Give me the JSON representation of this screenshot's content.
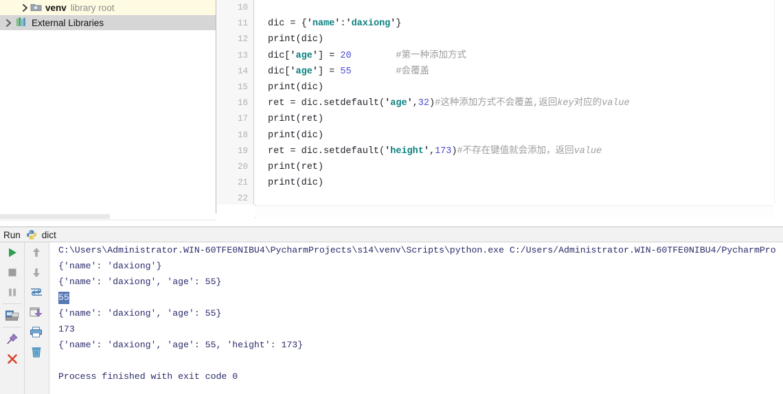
{
  "sidebar": {
    "rows": [
      {
        "label": "venv",
        "sublabel": "library root",
        "icon": "folder-icon",
        "chevron": "chevron-right-icon",
        "state": "highlighted"
      },
      {
        "label": "External Libraries",
        "sublabel": "",
        "icon": "library-bars-icon",
        "chevron": "chevron-right-icon",
        "state": "selected"
      }
    ]
  },
  "editor": {
    "line_numbers": [
      "10",
      "11",
      "12",
      "13",
      "14",
      "15",
      "16",
      "17",
      "18",
      "19",
      "20",
      "21",
      "22"
    ],
    "lines": [
      {
        "n": "10",
        "segments": []
      },
      {
        "n": "11",
        "segments": [
          {
            "t": "dic = {",
            "c": "plain"
          },
          {
            "t": "'",
            "c": "q"
          },
          {
            "t": "name",
            "c": "str"
          },
          {
            "t": "'",
            "c": "q"
          },
          {
            "t": ":",
            "c": "plain"
          },
          {
            "t": "'",
            "c": "q"
          },
          {
            "t": "daxiong",
            "c": "str"
          },
          {
            "t": "'",
            "c": "q"
          },
          {
            "t": "}",
            "c": "plain"
          }
        ]
      },
      {
        "n": "12",
        "segments": [
          {
            "t": "print(dic)",
            "c": "plain"
          }
        ]
      },
      {
        "n": "13",
        "segments": [
          {
            "t": "dic[",
            "c": "plain"
          },
          {
            "t": "'",
            "c": "q"
          },
          {
            "t": "age",
            "c": "str"
          },
          {
            "t": "'",
            "c": "q"
          },
          {
            "t": "] = ",
            "c": "plain"
          },
          {
            "t": "20",
            "c": "num"
          },
          {
            "t": "        ",
            "c": "plain"
          },
          {
            "t": "#第一种添加方式",
            "c": "cmt"
          }
        ]
      },
      {
        "n": "14",
        "segments": [
          {
            "t": "dic[",
            "c": "plain"
          },
          {
            "t": "'",
            "c": "q"
          },
          {
            "t": "age",
            "c": "str"
          },
          {
            "t": "'",
            "c": "q"
          },
          {
            "t": "] = ",
            "c": "plain"
          },
          {
            "t": "55",
            "c": "num"
          },
          {
            "t": "        ",
            "c": "plain"
          },
          {
            "t": "#会覆盖",
            "c": "cmt"
          }
        ]
      },
      {
        "n": "15",
        "segments": [
          {
            "t": "print(dic)",
            "c": "plain"
          }
        ]
      },
      {
        "n": "16",
        "segments": [
          {
            "t": "ret = dic.setdefault(",
            "c": "plain"
          },
          {
            "t": "'",
            "c": "q"
          },
          {
            "t": "age",
            "c": "str"
          },
          {
            "t": "'",
            "c": "q"
          },
          {
            "t": ",",
            "c": "plain"
          },
          {
            "t": "32",
            "c": "num"
          },
          {
            "t": ")",
            "c": "plain"
          },
          {
            "t": "#这种添加方式不会覆盖,返回",
            "c": "cmt"
          },
          {
            "t": "key",
            "c": "cmt-i"
          },
          {
            "t": "对应的",
            "c": "cmt"
          },
          {
            "t": "value",
            "c": "cmt-i"
          }
        ]
      },
      {
        "n": "17",
        "segments": [
          {
            "t": "print(ret)",
            "c": "plain"
          }
        ]
      },
      {
        "n": "18",
        "segments": [
          {
            "t": "print(dic)",
            "c": "plain"
          }
        ]
      },
      {
        "n": "19",
        "segments": [
          {
            "t": "ret = dic.setdefault(",
            "c": "plain"
          },
          {
            "t": "'",
            "c": "q"
          },
          {
            "t": "height",
            "c": "str"
          },
          {
            "t": "'",
            "c": "q"
          },
          {
            "t": ",",
            "c": "plain"
          },
          {
            "t": "173",
            "c": "num"
          },
          {
            "t": ")",
            "c": "plain"
          },
          {
            "t": "#不存在键值就会添加，返回",
            "c": "cmt"
          },
          {
            "t": "value",
            "c": "cmt-i"
          }
        ]
      },
      {
        "n": "20",
        "segments": [
          {
            "t": "print(ret)",
            "c": "plain"
          }
        ]
      },
      {
        "n": "21",
        "segments": [
          {
            "t": "print(dic)",
            "c": "plain"
          }
        ]
      },
      {
        "n": "22",
        "segments": []
      }
    ]
  },
  "run_panel": {
    "title": "Run",
    "tab_name": "dict",
    "tab_icon": "python-file-icon",
    "toolbar_left": [
      {
        "name": "rerun-button",
        "icon": "play-icon"
      },
      {
        "name": "stop-button",
        "icon": "stop-square-icon"
      },
      {
        "name": "pause-button",
        "icon": "pause-icon"
      },
      {
        "name": "restore-layout-button",
        "icon": "restore-layout-icon"
      },
      {
        "name": "pin-tab-button",
        "icon": "pin-icon"
      },
      {
        "name": "close-button",
        "icon": "close-x-icon"
      }
    ],
    "toolbar_right": [
      {
        "name": "up-the-stack-button",
        "icon": "arrow-up-icon"
      },
      {
        "name": "down-the-stack-button",
        "icon": "arrow-down-icon"
      },
      {
        "name": "soft-wrap-button",
        "icon": "soft-wrap-icon"
      },
      {
        "name": "export-to-file-button",
        "icon": "export-icon"
      },
      {
        "name": "print-button",
        "icon": "printer-icon"
      },
      {
        "name": "clear-all-button",
        "icon": "trash-icon"
      }
    ],
    "console": {
      "command_line": "C:\\Users\\Administrator.WIN-60TFE0NIBU4\\PycharmProjects\\s14\\venv\\Scripts\\python.exe C:/Users/Administrator.WIN-60TFE0NIBU4/PycharmPro",
      "lines": [
        {
          "text": "{'name': 'daxiong'}",
          "selected": false
        },
        {
          "text": "{'name': 'daxiong', 'age': 55}",
          "selected": false
        },
        {
          "text": "55",
          "selected": true
        },
        {
          "text": "{'name': 'daxiong', 'age': 55}",
          "selected": false
        },
        {
          "text": "173",
          "selected": false
        },
        {
          "text": "{'name': 'daxiong', 'age': 55, 'height': 173}",
          "selected": false
        },
        {
          "text": "",
          "selected": false
        },
        {
          "text": "Process finished with exit code 0",
          "selected": false
        }
      ]
    }
  },
  "colors": {
    "string_teal": "#0c8080",
    "number_blue": "#4a4ad2",
    "comment_gray": "#9d9d9d",
    "console_text": "#2b2b6b",
    "selection_blue": "#5878b4",
    "row_highlight_yellow": "#fffbe2",
    "row_selected_gray": "#d6d6d6",
    "play_green": "#2e9e4f",
    "close_red": "#d8452e"
  }
}
